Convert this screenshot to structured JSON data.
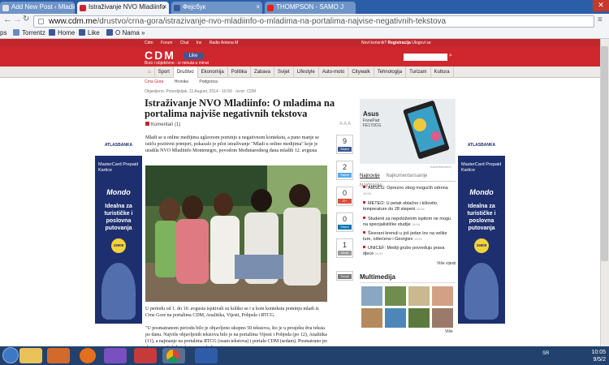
{
  "browser": {
    "tabs": [
      {
        "label": "Add New Post ‹ Mladiinfo ×",
        "active": false
      },
      {
        "label": "Istraživanje NVO Mladiinfo",
        "active": true
      },
      {
        "label": "Фејсбук",
        "active": false
      },
      {
        "label": "THOMPSON - SAMO J",
        "active": false
      }
    ],
    "url_host": "www.cdm.me",
    "url_path": "/drustvo/crna-gora/istrazivanje-nvo-mladiinfo-o-mladima-na-portalima-najvise-negativnih-tekstova",
    "bookmarks": [
      "ps",
      "Torrentz",
      "Home",
      "Like",
      "O Nama »"
    ]
  },
  "site": {
    "top_nav": [
      "Cdm",
      "Forum",
      "Chat",
      "Inz",
      "Radio Antena M"
    ],
    "top_right": [
      "Novi korisnik?",
      "Registracija",
      "Ulogovi se"
    ],
    "logo": "CDM",
    "tagline": "Brzo i objektivno - iz minuta u minut",
    "fb_like": "Like",
    "menu": [
      "Sport",
      "Društvo",
      "Ekonomija",
      "Politika",
      "Zabava",
      "Svijet",
      "Lifestyle",
      "Auto-moto",
      "Citywalk",
      "Tehnologija",
      "Turizam",
      "Kultura"
    ],
    "subnav": [
      "Crna Gora",
      "Hronika",
      "Podgorica"
    ]
  },
  "article": {
    "meta": "Objavljeno: Ponedjeljak, 11 August, 2014 - 16:59 · Izvor: CDM",
    "title": "Istraživanje NVO Mladiinfo: O mladima na portalima najviše negativnih tekstova",
    "comments": "Komentari (1)",
    "font_controls": "A A A",
    "lead": "Mladi se u online medijima uglavnom pominju u negativnom kontekstu, a puno manje se ističu pozitivni primjeri, pokazalo je pilot istraživanje \"Mladi u online medijima\" koje je uradila NVO Mladiinfo Montenegro, povodom Međunarodnog dana mladih 12. avgusta",
    "body1": "U periodu od 1. do 10. avgusta ispitivali su koliko se i u kom kontekstu pominju mladi iz Crne Gore na portalima CDM, Analitika, Vijesti, Pobjeda i RTCG.",
    "body2": "\"U posmatranom periodu bilo je objavljeno ukupno 50 tekstova, što je u prosjeku dva teksta po danu. Najviše objavljenih tekstova bilo je na portalima Vijesti i Pobjeda (po 12), Analitika (11), a najmanje na portalima RTCG (osam tekstova) i portalu CDM (sedam). Posmatrano po danu, najviše bilo tekstova o mladima je"
  },
  "share": [
    {
      "count": "9",
      "label": "Share",
      "color": "#3b5998"
    },
    {
      "count": "2",
      "label": "Tweet",
      "color": "#55acee"
    },
    {
      "count": "0",
      "label": "G+",
      "color": "#dd4b39"
    },
    {
      "count": "0",
      "label": "Share",
      "color": "#0077b5"
    },
    {
      "count": "1",
      "label": "Send",
      "color": "#999999"
    },
    {
      "count": "",
      "label": "Email",
      "color": "#777777"
    }
  ],
  "sidebar": {
    "ad_brand": "Asus",
    "ad_model": "FonePad FE170CG",
    "ad_label": "Advertisement",
    "tabs": [
      "Najnovije",
      "Najkomentarisanije",
      "Najčitanije"
    ],
    "news": [
      {
        "text": "AMSCG: Oprezno zbog mogućih odrona",
        "time": "16:56"
      },
      {
        "text": "METEO: U petak oblačno i kišovito, temperature do 28 stepeni",
        "time": "16:56"
      },
      {
        "text": "Studenti sa nepoloženim ispitom ne mogu na specijalističke studije",
        "time": "16:54"
      },
      {
        "text": "Šiverani krenuli u još jedan lov na velike ture, oštećeno i Georgiev",
        "time": "16:51"
      },
      {
        "text": "UNICEF: Mediji grubo povređuju prava djece",
        "time": "16:51"
      }
    ],
    "more_news": "Više vijesti",
    "multimedia_title": "Multimedija",
    "more_media": "Više"
  },
  "banner": {
    "bank": "ATLASBANKA",
    "card": "MasterCard Prepaid Kartice",
    "brand": "Mondo",
    "slogan": "Idealna za turističke i poslovna putovanja",
    "number": "19909"
  },
  "taskbar": {
    "lang": "SR",
    "time": "10:05",
    "date": "9/5/2"
  }
}
